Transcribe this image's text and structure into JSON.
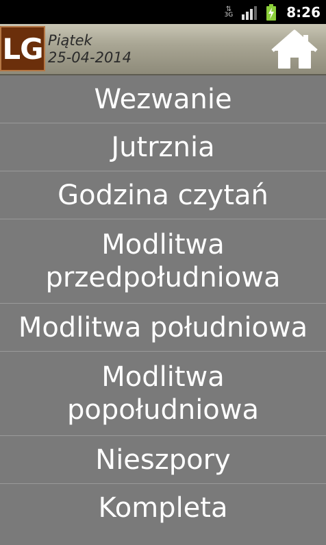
{
  "status_bar": {
    "network_label": "3G",
    "time": "8:26",
    "signal_icon": "signal-bars-icon",
    "battery_icon": "battery-charging-icon"
  },
  "header": {
    "logo_text": "LG",
    "day": "Piątek",
    "date": "25-04-2014",
    "home_icon": "home-icon"
  },
  "menu": {
    "items": [
      {
        "label": "Wezwanie"
      },
      {
        "label": "Jutrznia"
      },
      {
        "label": "Godzina czytań"
      },
      {
        "label": "Modlitwa przedpołudniowa"
      },
      {
        "label": "Modlitwa południowa"
      },
      {
        "label": "Modlitwa popołudniowa"
      },
      {
        "label": "Nieszpory"
      },
      {
        "label": "Kompleta"
      }
    ]
  },
  "colors": {
    "background": "#7a7a7a",
    "logo_background": "#6b2f0b",
    "text": "#ffffff"
  }
}
